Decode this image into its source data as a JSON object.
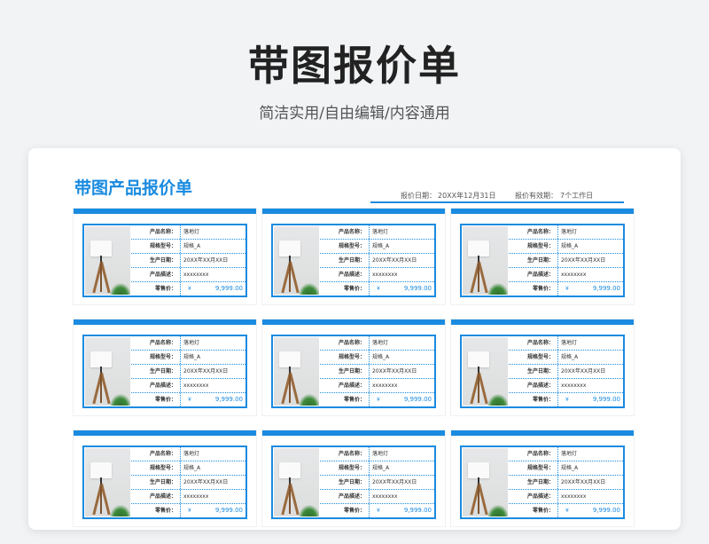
{
  "hero": {
    "title": "带图报价单",
    "subtitle": "简洁实用/自由编辑/内容通用"
  },
  "sheet": {
    "title": "带图产品报价单",
    "quote_date_label": "报价日期：",
    "quote_date": "20XX年12月31日",
    "valid_label": "报价有效期：",
    "valid_value": "7个工作日"
  },
  "labels": {
    "name": "产品名称：",
    "model": "规格型号：",
    "date": "生产日期：",
    "desc": "产品描述：",
    "price": "零售价："
  },
  "product": {
    "name": "落地灯",
    "model": "规格_A",
    "date": "20XX年XX月XX日",
    "desc": "xxxxxxxx",
    "currency": "¥",
    "price": "9,999.00"
  },
  "colors": {
    "accent": "#1a8be0",
    "background": "#f1f3f5"
  },
  "icons": {
    "product_image": "floor-lamp-photo"
  }
}
